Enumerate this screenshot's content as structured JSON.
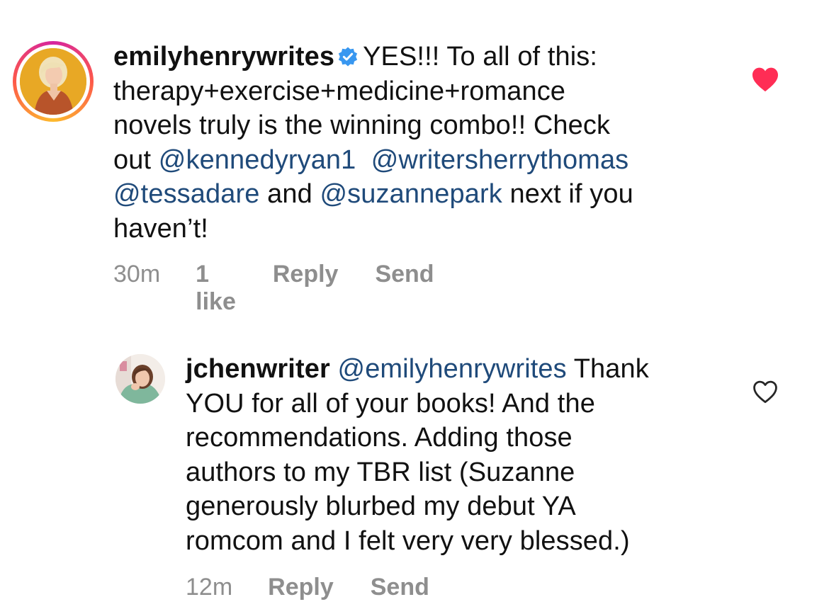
{
  "comments": [
    {
      "username": "emilyhenrywrites",
      "verified": true,
      "has_story_ring": true,
      "text_parts": {
        "t1": "YES!!! To all of this:",
        "t2": "therapy+exercise+medicine+romance",
        "t3": "novels truly is the winning combo!! Check",
        "t4": "out ",
        "m1": "@kennedyryan1",
        "t5": "  ",
        "m2": "@writersherrythomas",
        "m3": "@tessadare",
        "t6": " and ",
        "m4": "@suzannepark",
        "t7": " next if you",
        "t8": "haven’t!"
      },
      "time": "30m",
      "likes": "1 like",
      "reply_label": "Reply",
      "send_label": "Send",
      "liked": true,
      "heart_color": "#ff2d55"
    },
    {
      "username": "jchenwriter",
      "verified": false,
      "has_story_ring": false,
      "text_parts": {
        "m1": "@emilyhenrywrites",
        "t1": " Thank",
        "t2": "YOU for all of your books! And the",
        "t3": "recommendations. Adding those",
        "t4": "authors to my TBR list (Suzanne",
        "t5": "generously blurbed my debut YA",
        "t6": "romcom and I felt very very blessed.)"
      },
      "time": "12m",
      "reply_label": "Reply",
      "send_label": "Send",
      "liked": false,
      "heart_color": "#262626"
    }
  ],
  "colors": {
    "mention": "#1f4a7a",
    "meta": "#8e8e8e",
    "verified_badge": "#3897f0"
  },
  "icons": {
    "verified": "verified-badge-icon",
    "like_filled": "heart-filled-icon",
    "like_outline": "heart-outline-icon"
  }
}
